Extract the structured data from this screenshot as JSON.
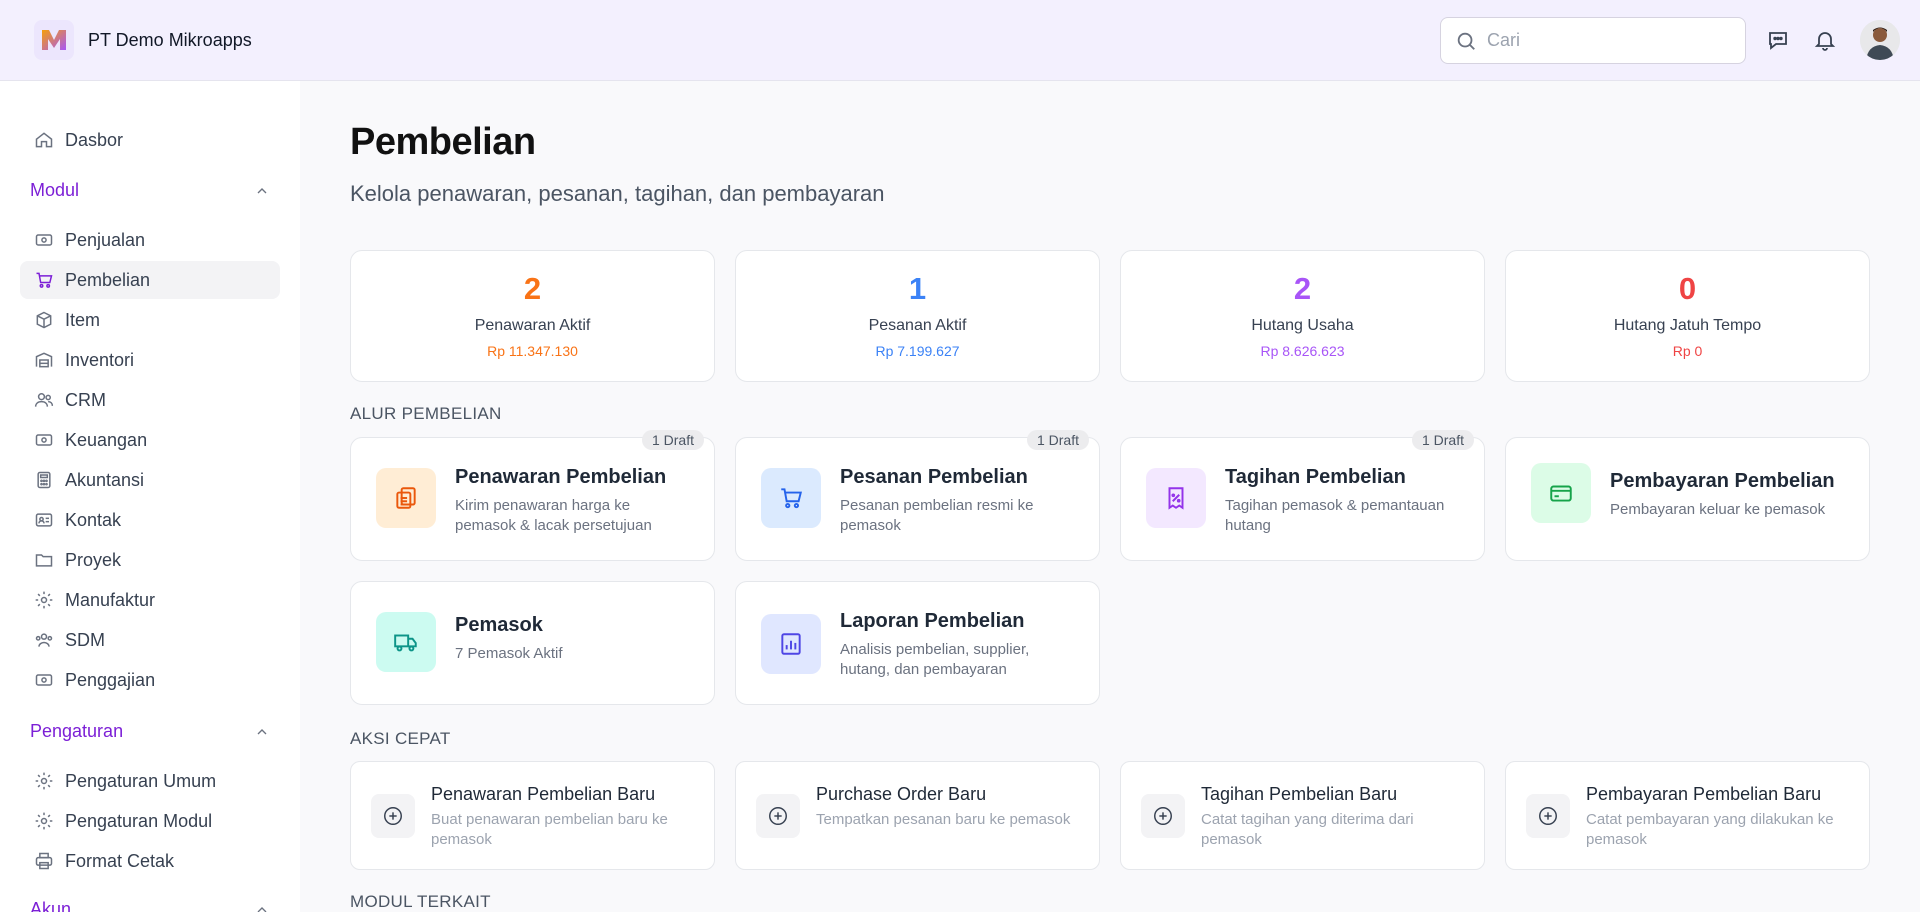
{
  "app": {
    "company": "PT Demo Mikroapps"
  },
  "colors": {
    "accent": "#7c1fd6",
    "orange": "#f97316",
    "blue": "#3b82f6",
    "purple": "#a855f7",
    "red": "#ef4444"
  },
  "search": {
    "placeholder": "Cari"
  },
  "sidebar": {
    "dashboard": "Dasbor",
    "module_section": "Modul",
    "modules": [
      {
        "label": "Penjualan",
        "icon": "cash-icon"
      },
      {
        "label": "Pembelian",
        "icon": "cart-icon",
        "active": true
      },
      {
        "label": "Item",
        "icon": "box-icon"
      },
      {
        "label": "Inventori",
        "icon": "warehouse-icon"
      },
      {
        "label": "CRM",
        "icon": "users-icon"
      },
      {
        "label": "Keuangan",
        "icon": "cash-icon"
      },
      {
        "label": "Akuntansi",
        "icon": "calculator-icon"
      },
      {
        "label": "Kontak",
        "icon": "contact-card-icon"
      },
      {
        "label": "Proyek",
        "icon": "folder-icon"
      },
      {
        "label": "Manufaktur",
        "icon": "gear-icon"
      },
      {
        "label": "SDM",
        "icon": "team-icon"
      },
      {
        "label": "Penggajian",
        "icon": "cash-icon"
      }
    ],
    "settings_section": "Pengaturan",
    "settings": [
      {
        "label": "Pengaturan Umum",
        "icon": "gear-icon"
      },
      {
        "label": "Pengaturan Modul",
        "icon": "gear-icon"
      },
      {
        "label": "Format Cetak",
        "icon": "printer-icon"
      }
    ],
    "account_section": "Akun"
  },
  "page": {
    "title": "Pembelian",
    "subtitle": "Kelola penawaran, pesanan, tagihan, dan pembayaran"
  },
  "stats": [
    {
      "value": "2",
      "label": "Penawaran Aktif",
      "amount": "Rp 11.347.130",
      "color": "#f97316"
    },
    {
      "value": "1",
      "label": "Pesanan Aktif",
      "amount": "Rp 7.199.627",
      "color": "#3b82f6"
    },
    {
      "value": "2",
      "label": "Hutang Usaha",
      "amount": "Rp 8.626.623",
      "color": "#a855f7"
    },
    {
      "value": "0",
      "label": "Hutang Jatuh Tempo",
      "amount": "Rp 0",
      "color": "#ef4444"
    }
  ],
  "flow": {
    "heading": "ALUR PEMBELIAN",
    "cards": [
      {
        "title": "Penawaran Pembelian",
        "desc": "Kirim penawaran harga ke pemasok & lacak persetujuan",
        "badge": "1 Draft",
        "icon": "clipboard-list-icon"
      },
      {
        "title": "Pesanan Pembelian",
        "desc": "Pesanan pembelian resmi ke pemasok",
        "badge": "1 Draft",
        "icon": "cart-icon"
      },
      {
        "title": "Tagihan Pembelian",
        "desc": "Tagihan pemasok & pemantauan hutang",
        "badge": "1 Draft",
        "icon": "receipt-percent-icon"
      },
      {
        "title": "Pembayaran Pembelian",
        "desc": "Pembayaran keluar ke pemasok",
        "badge": "",
        "icon": "credit-card-icon"
      },
      {
        "title": "Pemasok",
        "desc": "7 Pemasok Aktif",
        "badge": "",
        "icon": "truck-icon"
      },
      {
        "title": "Laporan Pembelian",
        "desc": "Analisis pembelian, supplier, hutang, dan pembayaran",
        "badge": "",
        "icon": "bar-chart-icon"
      }
    ]
  },
  "quick": {
    "heading": "AKSI CEPAT",
    "actions": [
      {
        "title": "Penawaran Pembelian Baru",
        "desc": "Buat penawaran pembelian baru ke pemasok"
      },
      {
        "title": "Purchase Order Baru",
        "desc": "Tempatkan pesanan baru ke pemasok"
      },
      {
        "title": "Tagihan Pembelian Baru",
        "desc": "Catat tagihan yang diterima dari pemasok"
      },
      {
        "title": "Pembayaran Pembelian Baru",
        "desc": "Catat pembayaran yang dilakukan ke pemasok"
      }
    ]
  },
  "related": {
    "heading": "MODUL TERKAIT"
  }
}
